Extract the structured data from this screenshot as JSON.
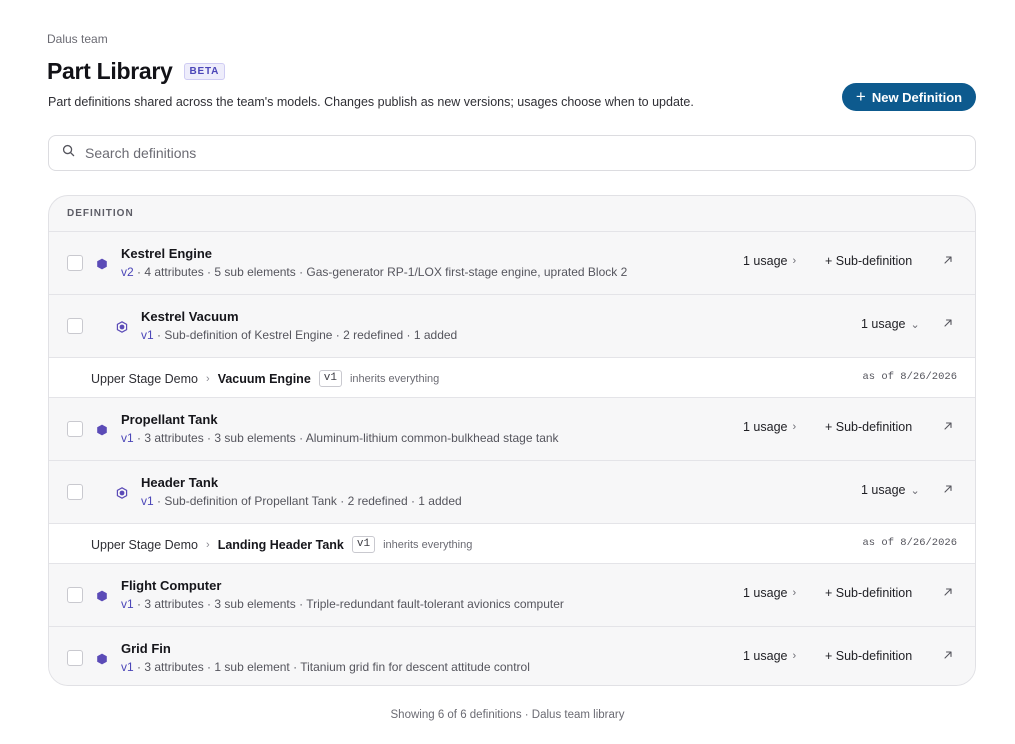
{
  "breadcrumb": "Dalus team",
  "page": {
    "title": "Part Library",
    "badge": "BETA",
    "subtitle": "Part definitions shared across the team's models. Changes publish as new versions; usages choose when to update."
  },
  "new_button": {
    "plus": "+",
    "label": "New Definition"
  },
  "search": {
    "placeholder": "Search definitions",
    "value": ""
  },
  "table": {
    "header": "DEFINITION",
    "rows": [
      {
        "name": "Kestrel Engine",
        "version": "v2",
        "meta": " · 4 attributes · 5 sub elements · Gas-generator RP-1/LOX first-stage engine, uprated Block 2",
        "usage": "1 usage",
        "usage_chev": "›",
        "subdef": "+ Sub-definition"
      },
      {
        "name": "Kestrel Vacuum",
        "version": "v1",
        "meta": " · Sub-definition of Kestrel Engine · 2 redefined · 1 added",
        "usage": "1 usage",
        "usage_chev": "⌄"
      },
      {
        "model": "Upper Stage Demo",
        "part": "Vacuum Engine",
        "version": "v1",
        "note": "inherits everything",
        "asof": "as of 8/26/2026"
      },
      {
        "name": "Propellant Tank",
        "version": "v1",
        "meta": " · 3 attributes · 3 sub elements · Aluminum-lithium common-bulkhead stage tank",
        "usage": "1 usage",
        "usage_chev": "›",
        "subdef": "+ Sub-definition"
      },
      {
        "name": "Header Tank",
        "version": "v1",
        "meta": " · Sub-definition of Propellant Tank · 2 redefined · 1 added",
        "usage": "1 usage",
        "usage_chev": "⌄"
      },
      {
        "model": "Upper Stage Demo",
        "part": "Landing Header Tank",
        "version": "v1",
        "note": "inherits everything",
        "asof": "as of 8/26/2026"
      },
      {
        "name": "Flight Computer",
        "version": "v1",
        "meta": " · 3 attributes · 3 sub elements · Triple-redundant fault-tolerant avionics computer",
        "usage": "1 usage",
        "usage_chev": "›",
        "subdef": "+ Sub-definition"
      },
      {
        "name": "Grid Fin",
        "version": "v1",
        "meta": " · 3 attributes · 1 sub element · Titanium grid fin for descent attitude control",
        "usage": "1 usage",
        "usage_chev": "›",
        "subdef": "+ Sub-definition"
      }
    ]
  },
  "footer": "Showing 6 of 6 definitions · Dalus team library",
  "icons": {
    "definition": "hexagon-icon",
    "sub_definition": "hexagon-outline-icon",
    "open": "arrow-up-right-icon",
    "search": "search-icon"
  },
  "colors": {
    "accent": "#0d5a8e",
    "version": "#4b46b8",
    "hexagon": "#5b4bb7"
  }
}
